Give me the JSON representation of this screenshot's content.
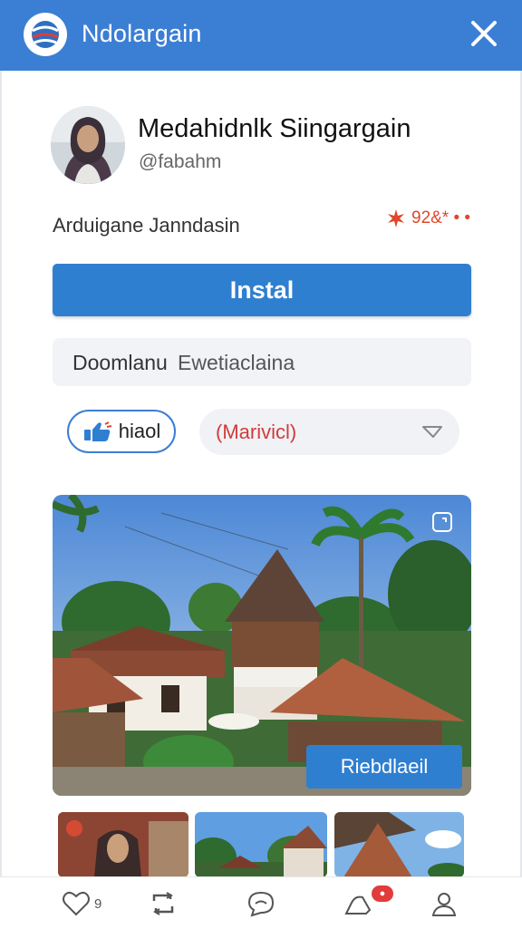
{
  "app": {
    "title": "Ndolargain"
  },
  "profile": {
    "name": "Medahidnlk Siingargain",
    "handle": "@fabahm"
  },
  "meta": {
    "subtitle": "Arduigane  Janndasin",
    "rating": "92&* • •"
  },
  "actions": {
    "install_label": "Instal"
  },
  "search": {
    "label": "Doomlanu",
    "value": "Ewetiaclaina"
  },
  "chips": {
    "like_label": "hiaol",
    "select_value": "(Marivicl)"
  },
  "hero": {
    "button_label": "Riebdlaeil"
  },
  "nav": {
    "like_count": "9"
  },
  "colors": {
    "accent": "#2f7fd0",
    "topbar": "#3b7fd4",
    "alert": "#e23b3b"
  }
}
